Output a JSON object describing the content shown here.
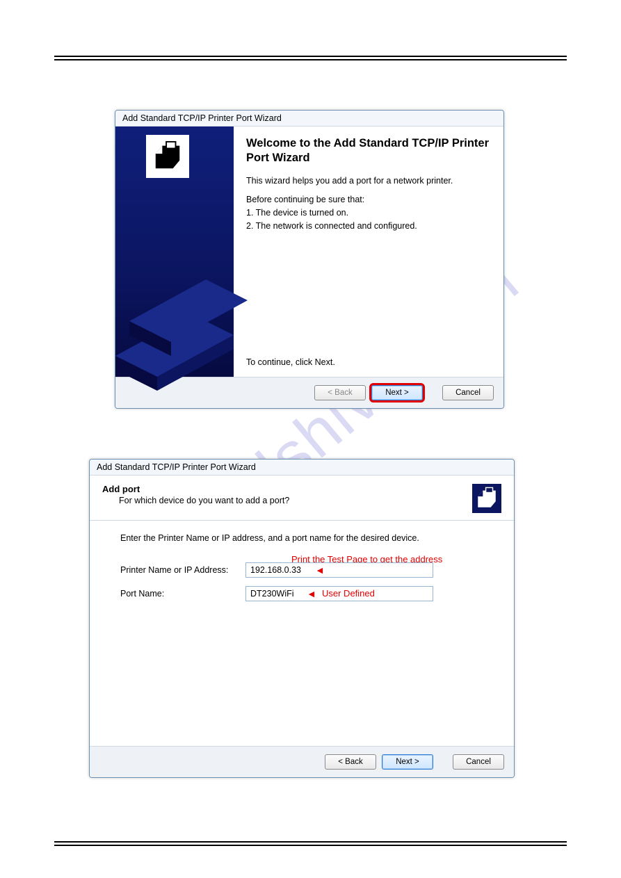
{
  "watermark": "manualshive.com",
  "dialog1": {
    "title": "Add Standard TCP/IP Printer Port Wizard",
    "heading": "Welcome to the Add Standard TCP/IP Printer Port Wizard",
    "intro": "This wizard helps you add a port for a network printer.",
    "before_heading": "Before continuing be sure that:",
    "before_item1": "1.  The device is turned on.",
    "before_item2": "2.  The network is connected and configured.",
    "continue": "To continue, click Next.",
    "back_label": "< Back",
    "next_label": "Next >",
    "cancel_label": "Cancel"
  },
  "dialog2": {
    "title": "Add Standard TCP/IP Printer Port Wizard",
    "header_title": "Add port",
    "header_sub": "For which device do you want to add a port?",
    "instruction": "Enter the Printer Name or IP address, and a port name for the desired device.",
    "field_ip_label": "Printer Name or IP Address:",
    "field_ip_value": "192.168.0.33",
    "field_port_label": "Port Name:",
    "field_port_value": "DT230WiFi",
    "annotation_ip": "Print the Test Page to get the address",
    "annotation_port": "User Defined",
    "back_label": "< Back",
    "next_label": "Next >",
    "cancel_label": "Cancel"
  }
}
